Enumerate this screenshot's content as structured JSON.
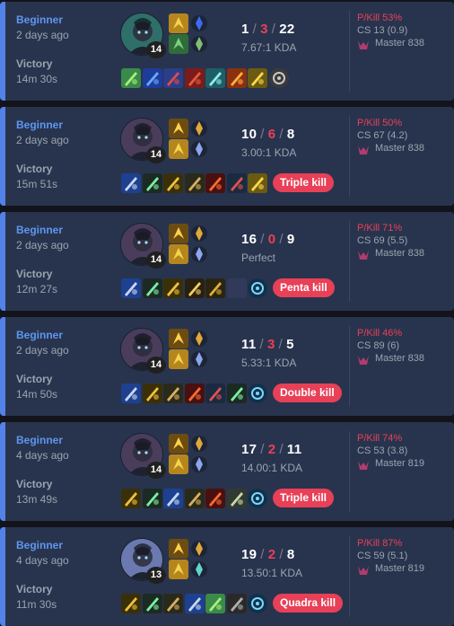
{
  "matches": [
    {
      "mode": "Beginner",
      "ago": "2 days ago",
      "result": "Victory",
      "duration": "14m 30s",
      "champion_icon": "champion-portrait-green",
      "level": "14",
      "spells": [
        "flash-icon",
        "ghost-icon"
      ],
      "runes": [
        "precision-rune-icon",
        "resolve-rune-icon"
      ],
      "kills": "1",
      "deaths": "3",
      "assists": "22",
      "kda_text": "7.67:1 KDA",
      "items": [
        "item-green",
        "item-blue",
        "item-blue-red",
        "item-red",
        "item-teal",
        "item-orange",
        "item-gold",
        "item-ward-gray"
      ],
      "badge": "",
      "pkill": "P/Kill 53%",
      "cs": "CS 13 (0.9)",
      "rank_icon": "master-rank-icon",
      "rank": "Master 838",
      "portrait_color": "#2f6f6a"
    },
    {
      "mode": "Beginner",
      "ago": "2 days ago",
      "result": "Victory",
      "duration": "15m 51s",
      "champion_icon": "champion-portrait-dark",
      "level": "14",
      "spells": [
        "heal-icon",
        "flash-icon"
      ],
      "runes": [
        "domination-rune-icon",
        "sorcery-rune-icon"
      ],
      "kills": "10",
      "deaths": "6",
      "assists": "8",
      "kda_text": "3.00:1 KDA",
      "items": [
        "item-boots",
        "item-blade",
        "item-gold-blade",
        "item-bow",
        "item-red-sword",
        "item-cleaver",
        "item-gold"
      ],
      "badge": "Triple kill",
      "pkill": "P/Kill 50%",
      "cs": "CS 67 (4.2)",
      "rank_icon": "master-rank-icon",
      "rank": "Master 838",
      "portrait_color": "#4a3d5c"
    },
    {
      "mode": "Beginner",
      "ago": "2 days ago",
      "result": "Victory",
      "duration": "12m 27s",
      "champion_icon": "champion-portrait-dark",
      "level": "14",
      "spells": [
        "heal-icon",
        "flash-icon"
      ],
      "runes": [
        "domination-rune-icon",
        "sorcery-rune-icon"
      ],
      "kills": "16",
      "deaths": "0",
      "assists": "9",
      "kda_text": "Perfect",
      "items": [
        "item-boots",
        "item-blade",
        "item-gold-blade",
        "item-cross-swords",
        "item-gold-blade2",
        "item-empty",
        "item-ward-blue"
      ],
      "badge": "Penta kill",
      "pkill": "P/Kill 71%",
      "cs": "CS 69 (5.5)",
      "rank_icon": "master-rank-icon",
      "rank": "Master 838",
      "portrait_color": "#4a3d5c"
    },
    {
      "mode": "Beginner",
      "ago": "2 days ago",
      "result": "Victory",
      "duration": "14m 50s",
      "champion_icon": "champion-portrait-dark",
      "level": "14",
      "spells": [
        "heal-icon",
        "flash-icon"
      ],
      "runes": [
        "domination-rune-icon",
        "sorcery-rune-icon"
      ],
      "kills": "11",
      "deaths": "3",
      "assists": "5",
      "kda_text": "5.33:1 KDA",
      "items": [
        "item-boots",
        "item-gold-blade",
        "item-bow",
        "item-red-sword",
        "item-cleaver",
        "item-blade",
        "item-ward-blue"
      ],
      "badge": "Double kill",
      "pkill": "P/Kill 46%",
      "cs": "CS 89 (6)",
      "rank_icon": "master-rank-icon",
      "rank": "Master 838",
      "portrait_color": "#4a3d5c"
    },
    {
      "mode": "Beginner",
      "ago": "4 days ago",
      "result": "Victory",
      "duration": "13m 49s",
      "champion_icon": "champion-portrait-dark",
      "level": "14",
      "spells": [
        "heal-icon",
        "flash-icon"
      ],
      "runes": [
        "domination-rune-icon",
        "sorcery-rune-icon"
      ],
      "kills": "17",
      "deaths": "2",
      "assists": "11",
      "kda_text": "14.00:1 KDA",
      "items": [
        "item-gold-blade",
        "item-blade",
        "item-boots",
        "item-bow",
        "item-red-sword",
        "item-greatsword",
        "item-ward-blue"
      ],
      "badge": "Triple kill",
      "pkill": "P/Kill 74%",
      "cs": "CS 53 (3.8)",
      "rank_icon": "master-rank-icon",
      "rank": "Master 819",
      "portrait_color": "#4a3d5c"
    },
    {
      "mode": "Beginner",
      "ago": "4 days ago",
      "result": "Victory",
      "duration": "11m 30s",
      "champion_icon": "champion-portrait-blue",
      "level": "13",
      "spells": [
        "heal-icon",
        "flash-icon"
      ],
      "runes": [
        "domination-rune-icon",
        "inspiration-rune-icon"
      ],
      "kills": "19",
      "deaths": "2",
      "assists": "8",
      "kda_text": "13.50:1 KDA",
      "items": [
        "item-gold-blade",
        "item-blade",
        "item-bow",
        "item-boots",
        "item-green",
        "item-pickaxe",
        "item-ward-blue"
      ],
      "badge": "Quadra kill",
      "pkill": "P/Kill 87%",
      "cs": "CS 59 (5.1)",
      "rank_icon": "master-rank-icon",
      "rank": "Master 819",
      "portrait_color": "#6a7ab0"
    }
  ],
  "colors": {
    "accent": "#5383e8",
    "card": "#28344e",
    "death": "#e84057",
    "badge": "#e84057"
  }
}
